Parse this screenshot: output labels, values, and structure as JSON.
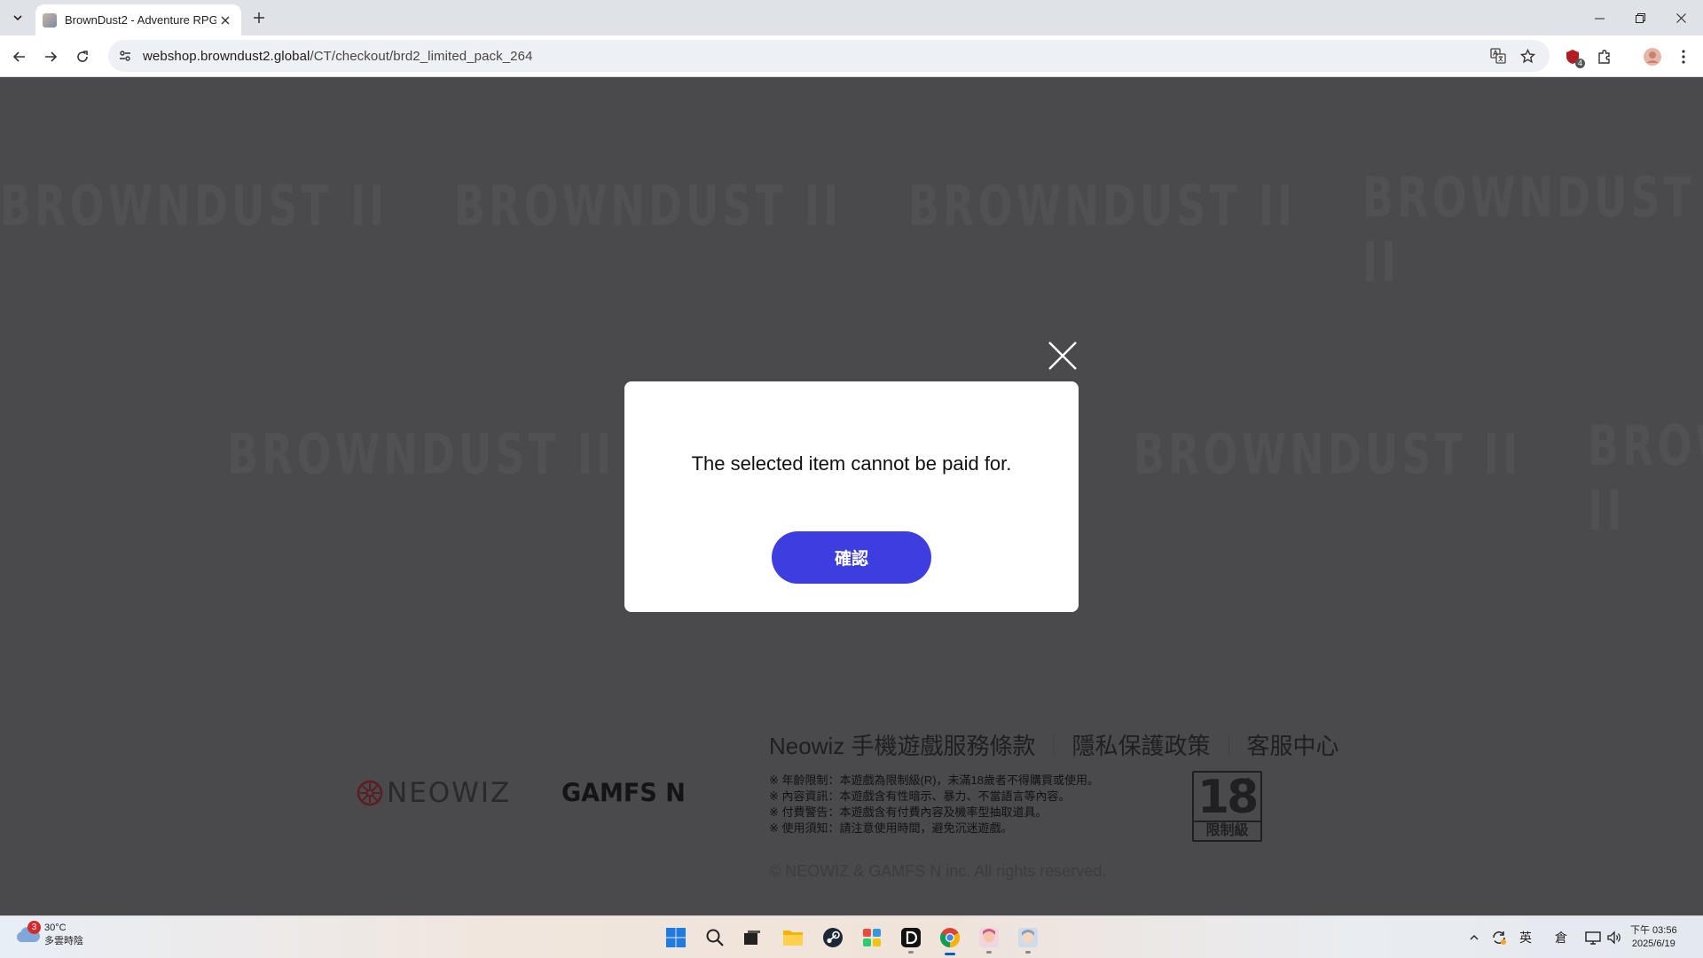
{
  "browser": {
    "tab_title": "BrownDust2 - Adventure RPG",
    "url_host": "webshop.browndust2.global",
    "url_path": "/CT/checkout/brd2_limited_pack_264",
    "extension_badge": "4"
  },
  "page": {
    "watermark": "BROWNDUST II",
    "modal": {
      "message": "The selected item cannot be paid for.",
      "confirm_label": "確認"
    },
    "footer": {
      "links": [
        "Neowiz 手機遊戲服務條款",
        "隱私保護政策",
        "客服中心"
      ],
      "logo_neowiz": "NEOWIZ",
      "logo_gamfs": "GAMFS N",
      "notices": [
        "※ 年齡限制：本遊戲為限制級(R)，未滿18歲者不得購買或使用。",
        "※ 內容資訊：本遊戲含有性暗示、暴力、不當語言等內容。",
        "※ 付費警告：本遊戲含有付費內容及機率型抽取道具。",
        "※ 使用須知：請注意使用時間，避免沉迷遊戲。"
      ],
      "rating_number": "18",
      "rating_plus": "+",
      "rating_label": "限制級",
      "copyright": "© NEOWIZ & GAMFS N inc. All rights reserved."
    }
  },
  "taskbar": {
    "weather_badge": "3",
    "temperature": "30°C",
    "weather_desc": "多雲時陰",
    "ime_lang": "英",
    "ime_mode": "倉",
    "clock_time": "下午 03:56",
    "clock_date": "2025/6/19"
  },
  "colors": {
    "confirm_button": "#3d3ee0",
    "overlay": "#4a4a4c"
  }
}
